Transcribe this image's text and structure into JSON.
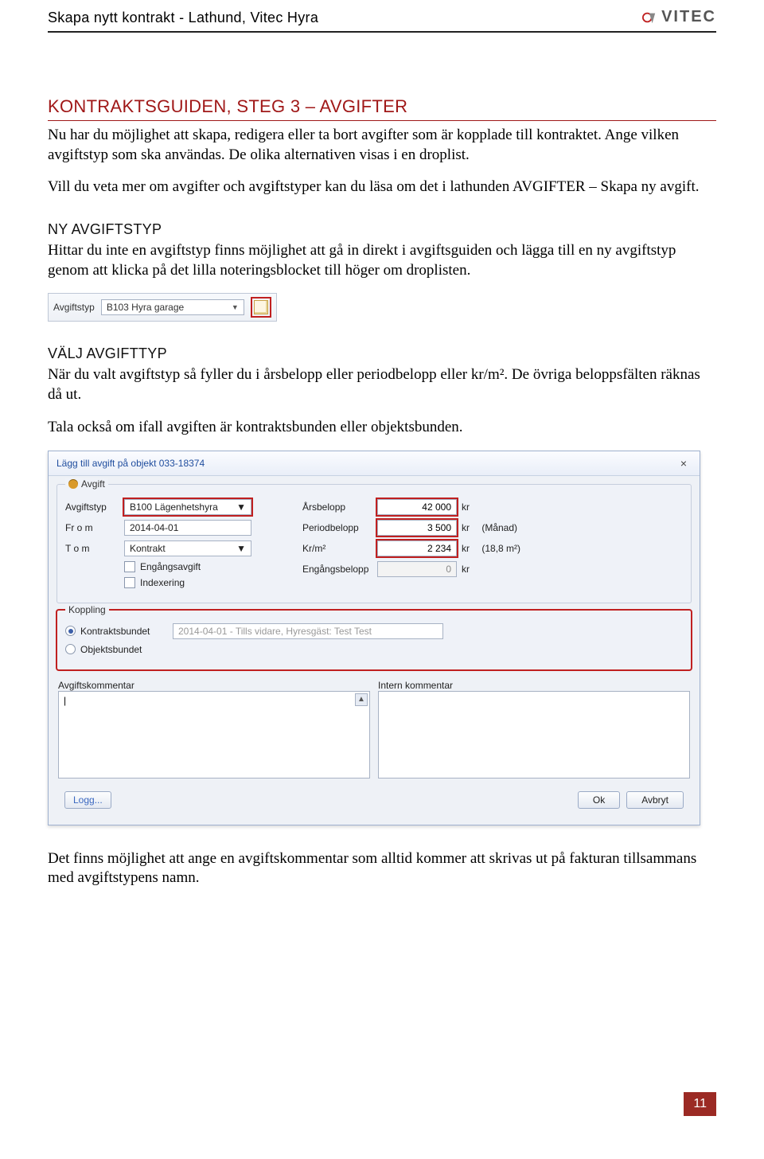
{
  "header": {
    "title": "Skapa nytt kontrakt - Lathund, Vitec Hyra",
    "brand": "VITEC"
  },
  "section": {
    "heading": "KONTRAKTSGUIDEN, STEG 3 – AVGIFTER",
    "p1": "Nu har du möjlighet att skapa, redigera eller ta bort avgifter som är kopplade till kontraktet. Ange vilken avgiftstyp som ska användas. De olika alternativen visas i en droplist.",
    "p2": "Vill du veta mer om avgifter och avgiftstyper kan du läsa om det i lathunden AVGIFTER – Skapa ny avgift."
  },
  "sub1": {
    "heading": "NY AVGIFTSTYP",
    "body": "Hittar du inte en avgiftstyp finns möjlighet att gå in direkt i avgiftsguiden och lägga till en ny avgiftstyp genom att klicka på det lilla noteringsblocket till höger om droplisten.",
    "dropdown_label": "Avgiftstyp",
    "dropdown_value": "B103  Hyra garage"
  },
  "sub2": {
    "heading": "VÄLJ AVGIFTTYP",
    "p1": "När du valt avgiftstyp så fyller du i årsbelopp eller periodbelopp eller kr/m². De övriga beloppsfälten räknas då ut.",
    "p2": "Tala också om ifall avgiften är kontraktsbunden eller objektsbunden."
  },
  "dialog": {
    "title": "Lägg till avgift på objekt 033-18374",
    "group_avgift": "Avgift",
    "labels": {
      "avgiftstyp": "Avgiftstyp",
      "from": "Fr o m",
      "tom": "T o m",
      "engangsavgift": "Engångsavgift",
      "indexering": "Indexering",
      "arsbelopp": "Årsbelopp",
      "periodbelopp": "Periodbelopp",
      "krm2": "Kr/m²",
      "engangsbelopp": "Engångsbelopp"
    },
    "values": {
      "avgiftstyp": "B100   Lägenhetshyra",
      "from": "2014-04-01",
      "tom": "Kontrakt",
      "arsbelopp": "42 000",
      "periodbelopp": "3 500",
      "krm2": "2 234",
      "engangsbelopp": "0"
    },
    "units": {
      "kr": "kr",
      "period": "(Månad)",
      "area": "(18,8 m²)"
    },
    "group_koppling": "Koppling",
    "radio": {
      "kontraktsbundet": "Kontraktsbundet",
      "objektsbundet": "Objektsbundet",
      "kontrakt_value": "2014-04-01 - Tills vidare, Hyresgäst: Test Test"
    },
    "comments": {
      "avgiftskommentar": "Avgiftskommentar",
      "intern_kommentar": "Intern kommentar"
    },
    "buttons": {
      "logg": "Logg...",
      "ok": "Ok",
      "avbryt": "Avbryt"
    }
  },
  "closing": "Det finns möjlighet att ange en avgiftskommentar som alltid kommer att skrivas ut på fakturan tillsammans med avgiftstypens namn.",
  "page_number": "11"
}
